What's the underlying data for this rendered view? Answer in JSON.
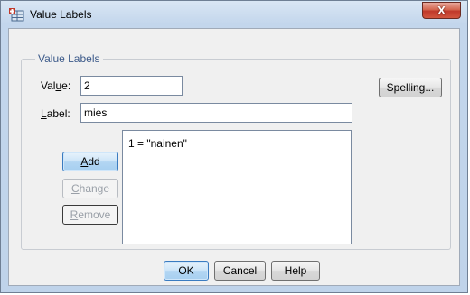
{
  "window": {
    "title": "Value Labels",
    "close_glyph": "X"
  },
  "group": {
    "legend": "Value Labels"
  },
  "value_field": {
    "label_prefix": "Val",
    "label_mnemonic": "u",
    "label_suffix": "e:",
    "value": "2"
  },
  "label_field": {
    "label_prefix": "",
    "label_mnemonic": "L",
    "label_suffix": "abel:",
    "value": "mies"
  },
  "buttons": {
    "spelling": "Spelling...",
    "add_mnemonic": "A",
    "add_rest": "dd",
    "change_mnemonic": "C",
    "change_rest": "hange",
    "remove_mnemonic": "R",
    "remove_rest": "emove",
    "ok": "OK",
    "cancel": "Cancel",
    "help": "Help"
  },
  "list": {
    "items": [
      "1 = \"nainen\""
    ]
  },
  "colors": {
    "accent": "#3a7bc0",
    "legend_text": "#3c5a8a",
    "close_button": "#c0392b"
  },
  "icons": {
    "title": "spss-value-labels-icon",
    "close": "close-icon"
  }
}
